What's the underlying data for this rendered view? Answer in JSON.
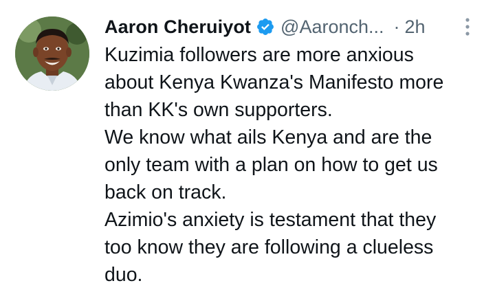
{
  "tweet": {
    "author": {
      "display_name": "Aaron Cheruiyot",
      "handle": "@Aaronch...",
      "verified_icon": "verified-badge-icon",
      "avatar": "profile-photo"
    },
    "separator": "·",
    "time": "2h",
    "more_icon": "more-vertical-icon",
    "lines": [
      "Kuzimia followers are more anxious",
      "about Kenya Kwanza's Manifesto more",
      "than KK's own supporters.",
      "We know what ails Kenya and are the",
      "only team with a plan on how to get us",
      "back on track.",
      "Azimio's anxiety is testament that they",
      "too know they are following a clueless",
      "duo."
    ]
  },
  "colors": {
    "text": "#0f1419",
    "muted": "#536471",
    "verified": "#1d9bf0",
    "background": "#ffffff"
  }
}
